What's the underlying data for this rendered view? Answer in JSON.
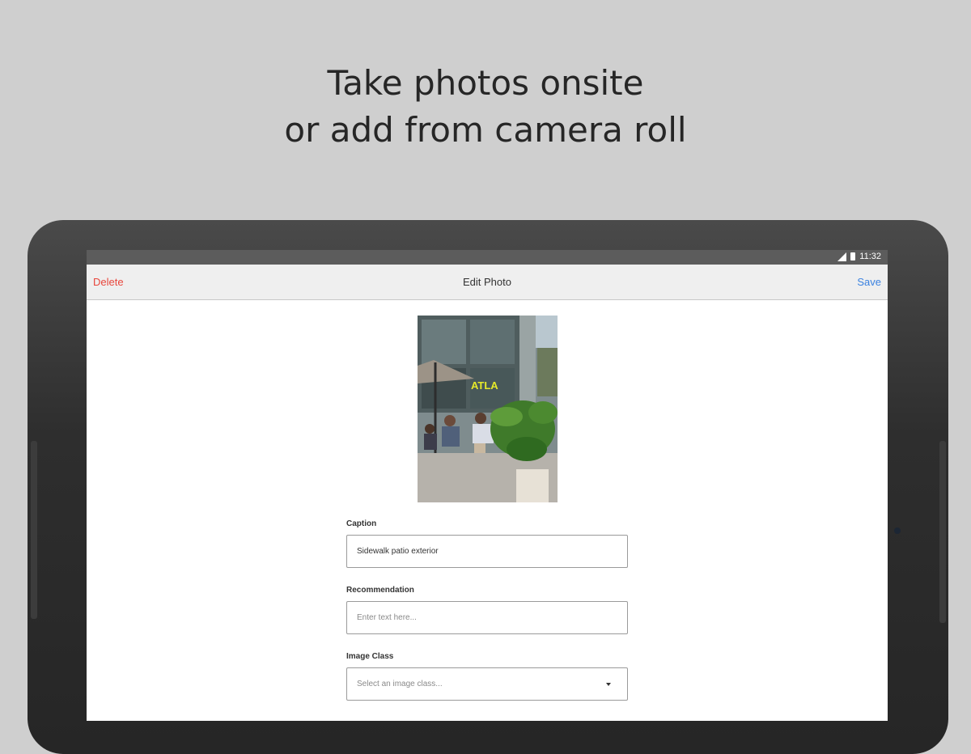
{
  "headline": {
    "line1": "Take photos onsite",
    "line2": "or add from camera roll"
  },
  "status_bar": {
    "time": "11:32",
    "icons": [
      "signal-icon",
      "battery-icon"
    ]
  },
  "nav": {
    "delete_label": "Delete",
    "title": "Edit Photo",
    "save_label": "Save"
  },
  "photo": {
    "sign_text": "ATLA"
  },
  "form": {
    "caption": {
      "label": "Caption",
      "value": "Sidewalk patio exterior"
    },
    "recommendation": {
      "label": "Recommendation",
      "placeholder": "Enter text here..."
    },
    "image_class": {
      "label": "Image Class",
      "placeholder": "Select an image class..."
    }
  },
  "colors": {
    "delete": "#e8463c",
    "save": "#3b82e0",
    "background": "#cfcfcf"
  }
}
